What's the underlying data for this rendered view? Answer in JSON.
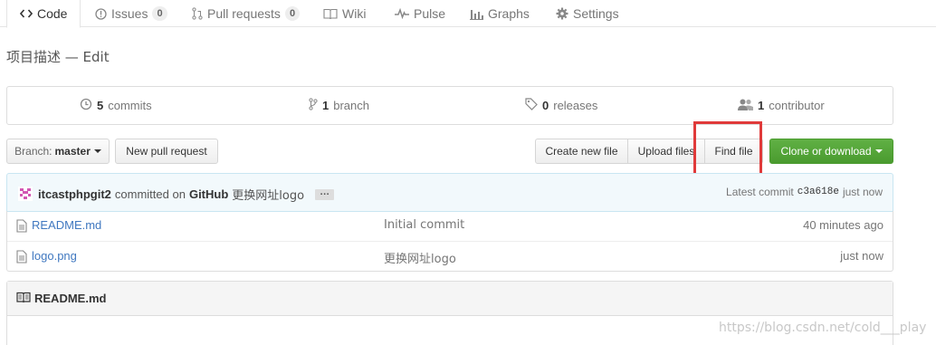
{
  "tabs": [
    {
      "label": "Code",
      "icon": "code-icon",
      "selected": true
    },
    {
      "label": "Issues",
      "icon": "issue-icon",
      "count": "0"
    },
    {
      "label": "Pull requests",
      "icon": "pull-request-icon",
      "count": "0"
    },
    {
      "label": "Wiki",
      "icon": "book-icon"
    },
    {
      "label": "Pulse",
      "icon": "pulse-icon"
    },
    {
      "label": "Graphs",
      "icon": "graph-icon"
    },
    {
      "label": "Settings",
      "icon": "gear-icon"
    }
  ],
  "repo_description": "项目描述 — Edit",
  "summary": {
    "commits": {
      "count": "5",
      "label": "commits"
    },
    "branches": {
      "count": "1",
      "label": "branch"
    },
    "releases": {
      "count": "0",
      "label": "releases"
    },
    "contributors": {
      "count": "1",
      "label": "contributor"
    }
  },
  "branch_button": {
    "prefix": "Branch:",
    "value": "master"
  },
  "new_pull_request": "New pull request",
  "file_buttons": {
    "create": "Create new file",
    "upload": "Upload files",
    "find": "Find file",
    "clone": "Clone or download"
  },
  "commit": {
    "author": "itcastphpgit2",
    "committed_on": "committed on",
    "platform": "GitHub",
    "message": "更换网址logo",
    "expander": "…",
    "latest_label": "Latest commit",
    "sha": "c3a618e",
    "age": "just now"
  },
  "files": [
    {
      "name": "README.md",
      "message": "Initial commit",
      "age": "40 minutes ago"
    },
    {
      "name": "logo.png",
      "message": "更换网址logo",
      "age": "just now"
    }
  ],
  "readme_title": "README.md",
  "watermark": "https://blog.csdn.net/cold___play",
  "colors": {
    "accent_tab": "#d26911",
    "link": "#4078c0",
    "clone_button": "#4a9b2f",
    "highlight": "#e03a3a"
  }
}
